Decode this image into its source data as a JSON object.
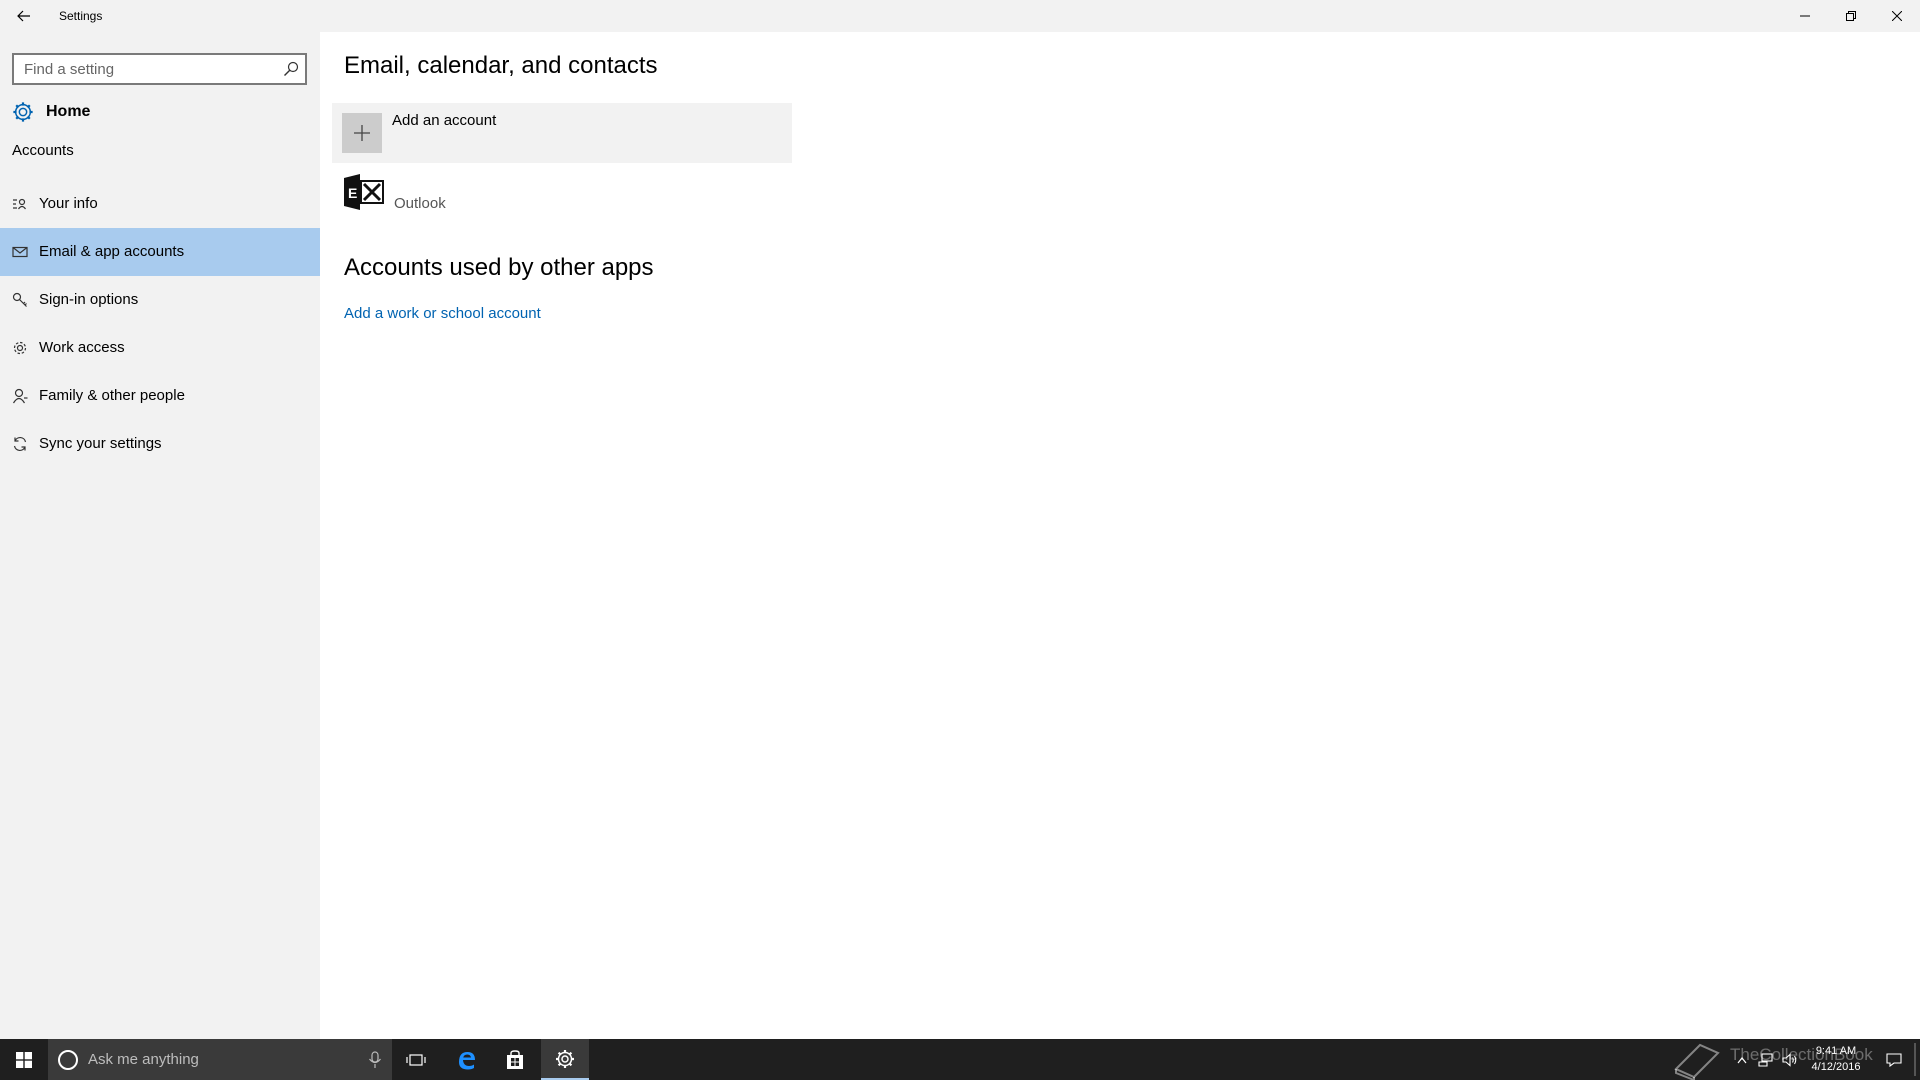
{
  "window": {
    "title": "Settings",
    "back_icon": "arrow-left-icon",
    "minimize_icon": "minimize-icon",
    "restore_icon": "restore-icon",
    "close_icon": "close-icon"
  },
  "sidebar": {
    "search_placeholder": "Find a setting",
    "home_label": "Home",
    "section_label": "Accounts",
    "items": [
      {
        "label": "Your info",
        "icon": "contact-card-icon",
        "selected": false
      },
      {
        "label": "Email & app accounts",
        "icon": "mail-icon",
        "selected": true
      },
      {
        "label": "Sign-in options",
        "icon": "key-icon",
        "selected": false
      },
      {
        "label": "Work access",
        "icon": "briefcase-gear-icon",
        "selected": false
      },
      {
        "label": "Family & other people",
        "icon": "person-icon",
        "selected": false
      },
      {
        "label": "Sync your settings",
        "icon": "sync-icon",
        "selected": false
      }
    ]
  },
  "main": {
    "heading": "Email, calendar, and contacts",
    "add_account_label": "Add an account",
    "accounts": [
      {
        "label": "Outlook",
        "icon": "exchange-icon"
      }
    ],
    "other_apps_heading": "Accounts used by other apps",
    "add_work_link": "Add a work or school account"
  },
  "taskbar": {
    "search_placeholder": "Ask me anything",
    "time": "9:41 AM",
    "date": "4/12/2016",
    "watermark": "TheCollectionBook"
  },
  "colors": {
    "accent": "#0063b1",
    "selected_bg": "#a8cbee",
    "sidebar_bg": "#f2f2f2",
    "taskbar_bg": "#1f1f1f"
  }
}
